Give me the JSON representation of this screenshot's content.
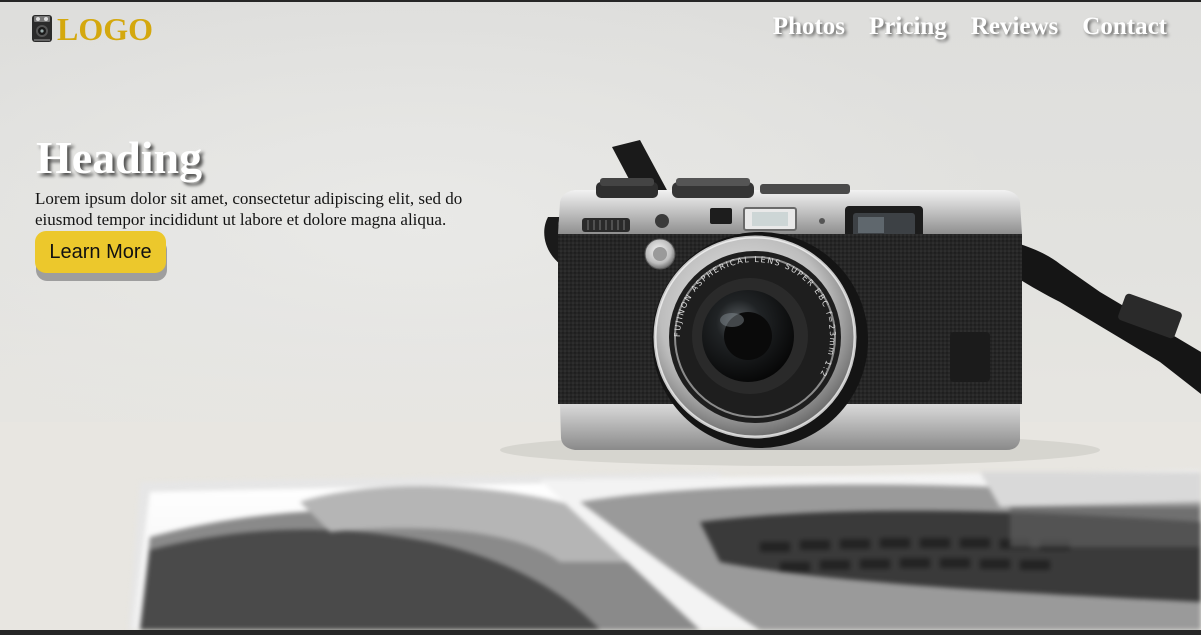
{
  "header": {
    "logo_text": "LOGO",
    "logo_icon": "vintage-camera-icon",
    "nav": [
      {
        "label": "Photos"
      },
      {
        "label": "Pricing"
      },
      {
        "label": "Reviews"
      },
      {
        "label": "Contact"
      }
    ]
  },
  "hero": {
    "heading": "Heading",
    "text": "Lorem ipsum dolor sit amet, consectetur adipiscing elit, sed do eiusmod tempor incididunt ut labore et dolore magna aliqua.",
    "cta_label": "Learn More",
    "camera_lens_text": "FUJINON ASPHERICAL LENS SUPER EBC f=23mm 1:2"
  },
  "colors": {
    "accent": "#ecc82c",
    "logo": "#d4a80e",
    "nav_text": "#ffffff",
    "camera_body": "#1f1f1f",
    "camera_chrome": "#c9c9c9"
  }
}
